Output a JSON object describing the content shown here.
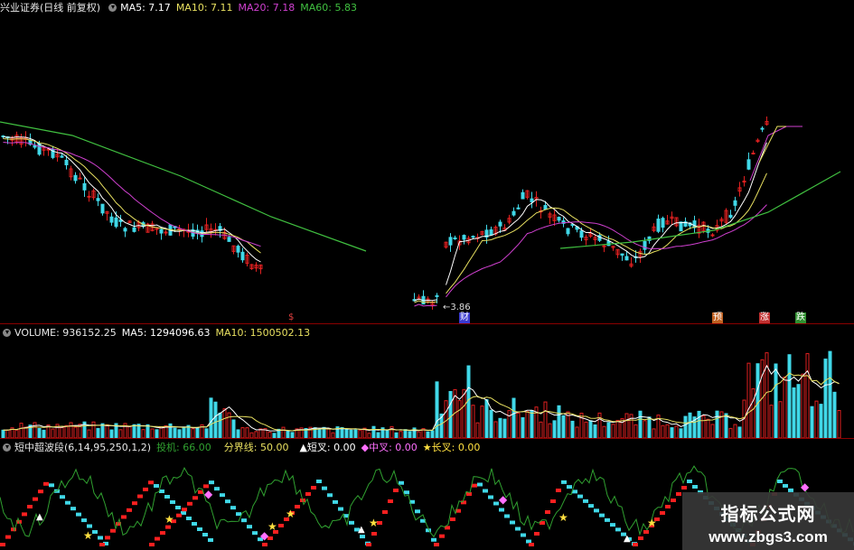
{
  "colors": {
    "up": "#e02020",
    "down": "#40d8e8",
    "ma5": "#ffffff",
    "ma10": "#e8e060",
    "ma20": "#d040d0",
    "ma60": "#40c040",
    "sep": "#8b0000",
    "osc_up": "#ff2020",
    "osc_down": "#40d8e8",
    "osc_line": "#30a030"
  },
  "price_legend": {
    "title": "兴业证券(日线 前复权)",
    "ma5": "MA5: 7.17",
    "ma10": "MA10: 7.11",
    "ma20": "MA20: 7.18",
    "ma60": "MA60: 5.83"
  },
  "price_annotations": {
    "low_label": "←3.86",
    "events": [
      "$",
      "财",
      "预",
      "涨",
      "跌"
    ]
  },
  "volume_legend": {
    "label": "VOLUME: 936152.25",
    "ma5": "MA5: 1294096.63",
    "ma10": "MA10: 1500502.13"
  },
  "osc_legend": {
    "title": "短中超波段(6,14,95,250,1,2)",
    "tz": "投机: 66.00",
    "fjx": "分界线: 50.00",
    "short": "▲短叉: 0.00",
    "mid": "◆中叉: 0.00",
    "long": "★长叉: 0.00"
  },
  "watermark": {
    "cn": "指标公式网",
    "url": "www.zbgs3.com"
  }
}
